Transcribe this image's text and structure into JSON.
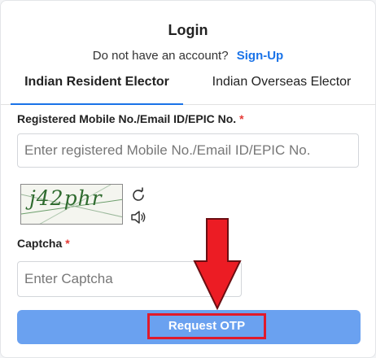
{
  "login": {
    "title": "Login",
    "no_account_text": "Do not have an account?",
    "signup_link": "Sign-Up"
  },
  "tabs": [
    {
      "label": "Indian Resident Elector",
      "active": true
    },
    {
      "label": "Indian Overseas Elector",
      "active": false
    }
  ],
  "form": {
    "mobile_label": "Registered Mobile No./Email ID/EPIC No.",
    "mobile_required": "*",
    "mobile_placeholder": "Enter registered Mobile No./Email ID/EPIC No.",
    "mobile_value": "",
    "captcha_image_text": "j42phr",
    "captcha_label": "Captcha",
    "captcha_required": "*",
    "captcha_placeholder": "Enter Captcha",
    "captcha_value": "",
    "submit_label": "Request OTP"
  },
  "icons": {
    "refresh": "refresh-icon",
    "audio": "speaker-icon"
  },
  "colors": {
    "accent": "#1a73e8",
    "submit_bg": "#6aa1f0",
    "highlight_red": "#e01a2b",
    "required": "#e53935"
  }
}
